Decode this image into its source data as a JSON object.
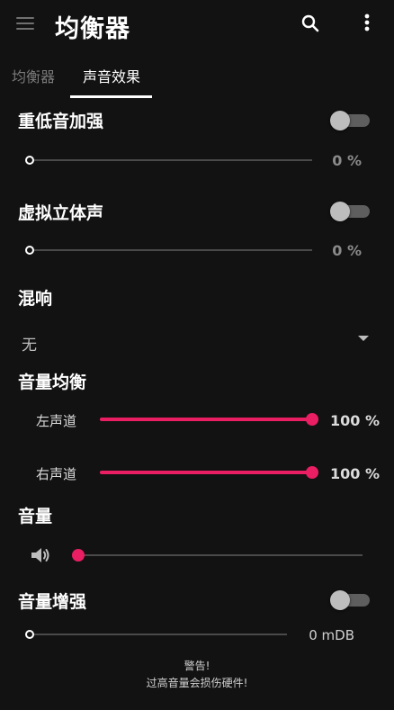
{
  "app": {
    "title": "均衡器"
  },
  "toolbar": {
    "menu_icon": "hamburger-menu-icon",
    "search_icon": "search-icon",
    "more_icon": "more-vert-icon"
  },
  "tabs": [
    {
      "label": "均衡器",
      "selected": false
    },
    {
      "label": "声音效果",
      "selected": true
    }
  ],
  "bass_boost": {
    "title": "重低音加强",
    "enabled": false,
    "value_text": "0 %",
    "level": 0
  },
  "virtualizer": {
    "title": "虚拟立体声",
    "enabled": false,
    "value_text": "0 %",
    "level": 0
  },
  "reverb": {
    "title": "混响",
    "selected": "无",
    "arrow_icon": "dropdown-arrow-icon"
  },
  "balance": {
    "title": "音量均衡",
    "left": {
      "label": "左声道",
      "value_text": "100 %",
      "level": 1.0
    },
    "right": {
      "label": "右声道",
      "value_text": "100 %",
      "level": 1.0
    }
  },
  "volume": {
    "title": "音量",
    "icon": "speaker-icon",
    "level": 0
  },
  "loudness": {
    "title": "音量增强",
    "enabled": false,
    "value_text": "0 mDB",
    "level": 0,
    "warning_line1": "警告!",
    "warning_line2": "过高音量会损伤硬件!"
  },
  "colors": {
    "accent": "#e91e63",
    "background": "#121212",
    "rail": "#4a4a4a"
  }
}
